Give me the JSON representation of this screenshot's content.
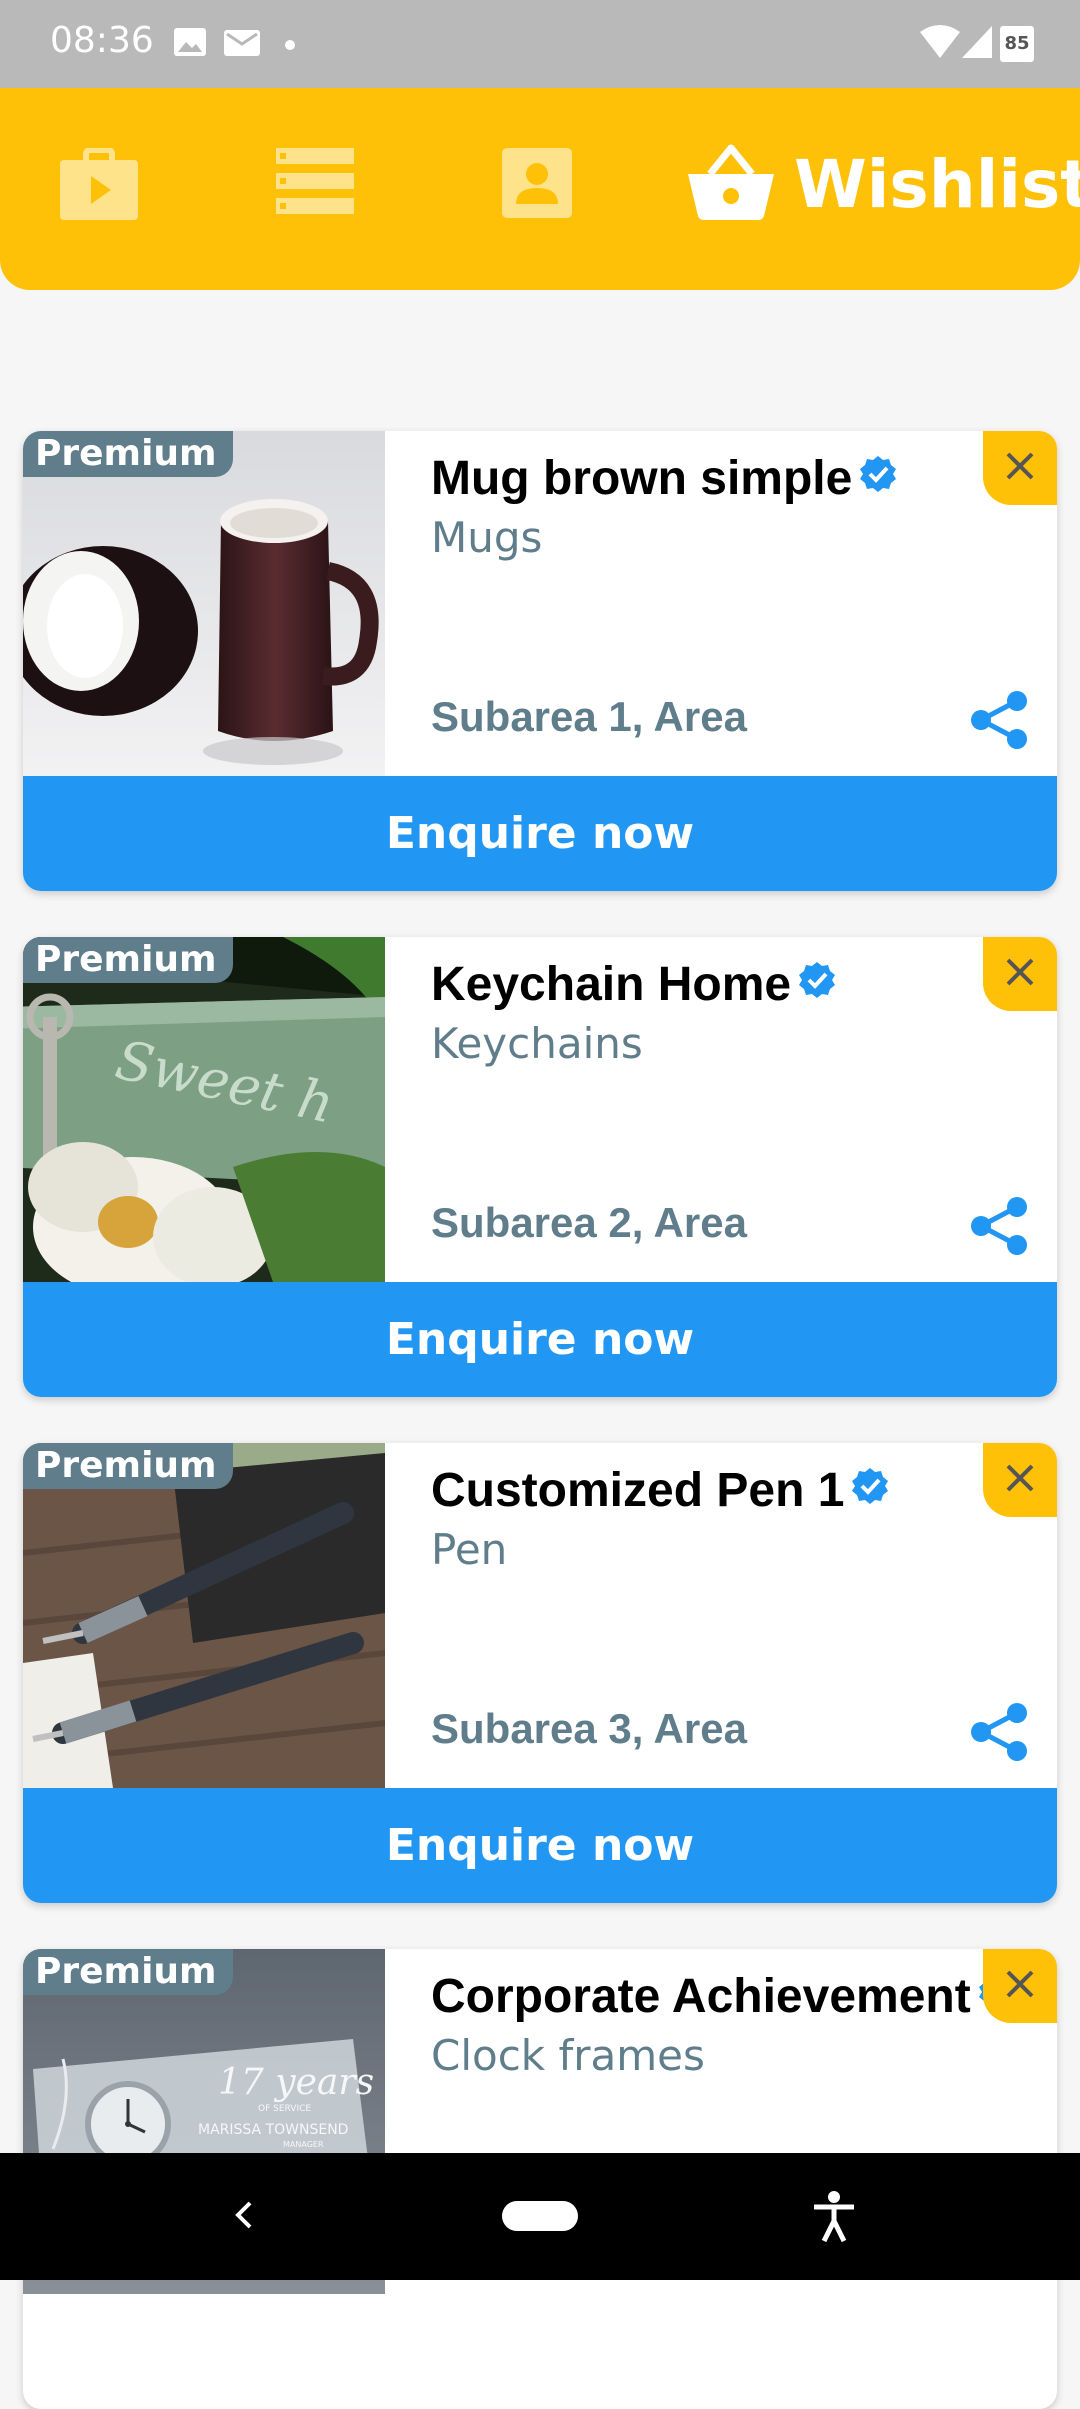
{
  "status_bar": {
    "time": "08:36",
    "battery": "85",
    "icons": [
      "image-icon",
      "mail-icon",
      "dot-icon",
      "wifi-icon",
      "signal-icon",
      "battery-icon"
    ]
  },
  "top_nav": {
    "items": [
      {
        "icon": "shop-bag-icon"
      },
      {
        "icon": "list-icon"
      },
      {
        "icon": "contact-card-icon"
      }
    ],
    "active": {
      "icon": "basket-icon",
      "label": "Wishlist"
    }
  },
  "colors": {
    "accent": "#ffc107",
    "primary": "#2196f3",
    "badge": "#607d8b",
    "verified": "#2196f3"
  },
  "cards": [
    {
      "badge": "Premium",
      "title": "Mug brown simple",
      "category": "Mugs",
      "location": "Subarea 1, Area",
      "cta": "Enquire now",
      "image": "mug"
    },
    {
      "badge": "Premium",
      "title": "Keychain Home",
      "category": "Keychains",
      "location": "Subarea 2, Area",
      "cta": "Enquire now",
      "image": "keychain"
    },
    {
      "badge": "Premium",
      "title": "Customized Pen 1",
      "category": "Pen",
      "location": "Subarea 3, Area",
      "cta": "Enquire now",
      "image": "pen"
    },
    {
      "badge": "Premium",
      "title": "Corporate Achievement",
      "category": "Clock frames",
      "image": "clock-frame",
      "image_text": {
        "line1": "17 years",
        "line2": "OF SERVICE",
        "line3": "MARISSA TOWNSEND",
        "line4": "MANAGER"
      }
    }
  ],
  "system_nav": {
    "icons": [
      "back-icon",
      "home-pill-icon",
      "accessibility-icon"
    ]
  }
}
